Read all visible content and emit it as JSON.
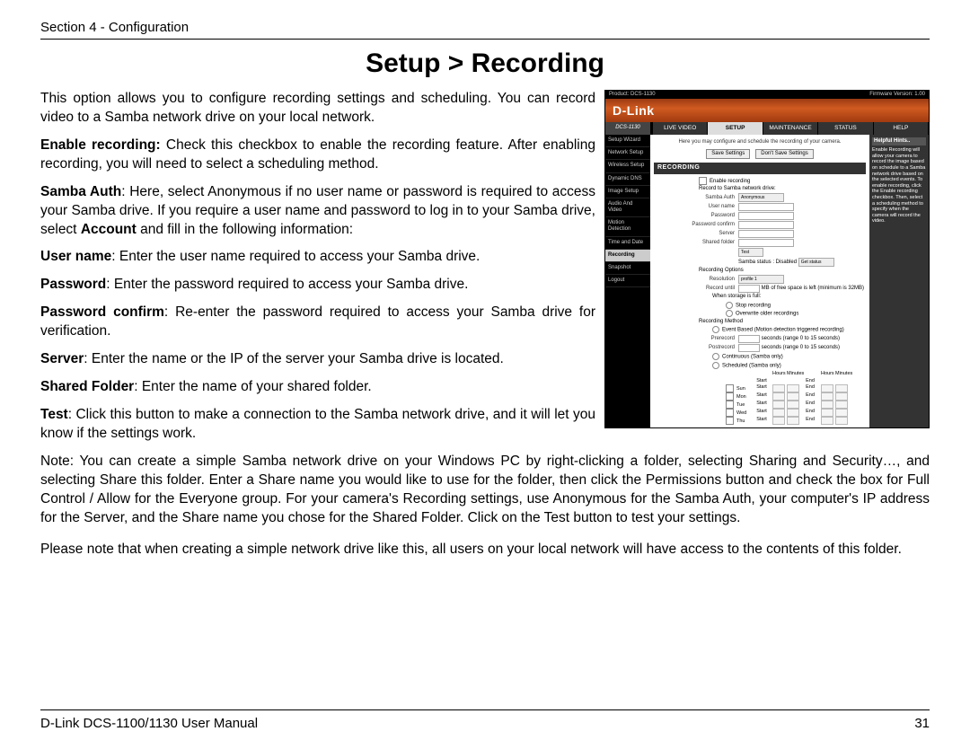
{
  "header": "Section 4 - Configuration",
  "title": "Setup > Recording",
  "intro": "This option allows you to configure recording settings and scheduling. You can record video to a Samba network drive on your local network.",
  "items": {
    "enable_b": "Enable recording:",
    "enable_t": " Check this checkbox to enable the recording feature. After enabling recording, you will need to select a scheduling method.",
    "samba_b": "Samba Auth",
    "samba_t1": ": Here, select Anonymous if no user name or password is required to access your Samba drive. If you require a user name and password to log in to your Samba drive, select ",
    "samba_b2": "Account",
    "samba_t2": " and fill in the following information:",
    "user_b": "User name",
    "user_t": ": Enter the user name required to access your Samba drive.",
    "pass_b": "Password",
    "pass_t": ": Enter the password required to access your Samba drive.",
    "passc_b": "Password confirm",
    "passc_t": ": Re-enter the password required to access your Samba drive for verification.",
    "server_b": "Server",
    "server_t": ": Enter the name or the IP of the server your Samba drive is located.",
    "shared_b": "Shared Folder",
    "shared_t": ": Enter the name of your shared folder.",
    "test_b": "Test",
    "test_t": ": Click this button to make a connection to the Samba network drive, and it will let you know if the settings work."
  },
  "note": {
    "b1": "Note",
    "t1": ": You can create a simple Samba network drive on your Windows PC by right-clicking a folder, selecting ",
    "b2": "Sharing and Security…",
    "t2": ", and selecting ",
    "b3": "Share this folder",
    "t3": ". Enter a ",
    "b4": "Share name",
    "t4": " you would like to use for the folder, then click the ",
    "b5": "Permissions",
    "t5": " button and check the box for ",
    "b6": "Full Control / Allow",
    "t6": " for the ",
    "b7": "Everyone",
    "t7": " group. For your camera's Recording settings, use Anonymous for the Samba Auth, your computer's IP address for the Server, and the Share name you chose for the Shared Folder. Click on the Test button to test your settings."
  },
  "closing": "Please note that when creating a simple network drive like this, all users on your local network will have access to the contents of this folder.",
  "footer_left": "D-Link DCS-1100/1130 User Manual",
  "footer_right": "31",
  "shot": {
    "product": "Product: DCS-1130",
    "fw": "Firmware Version: 1.00",
    "brand": "D-Link",
    "model": "DCS-1130",
    "tabs": [
      "LIVE VIDEO",
      "SETUP",
      "MAINTENANCE",
      "STATUS",
      "HELP"
    ],
    "side": [
      "Setup Wizard",
      "Network Setup",
      "Wireless Setup",
      "Dynamic DNS",
      "Image Setup",
      "Audio And Video",
      "Motion Detection",
      "Time and Date",
      "Recording",
      "Snapshot",
      "Logout"
    ],
    "desc": "Here you may configure and schedule the recording of your camera.",
    "btn_save": "Save Settings",
    "btn_dont": "Don't Save Settings",
    "sec_rec": "RECORDING",
    "f_enable": "Enable recording",
    "f_record_to": "Record to Samba network drive:",
    "f_samba_auth": "Samba Auth",
    "f_samba_val": "Anonymous",
    "f_user": "User name",
    "f_pass": "Password",
    "f_passc": "Password confirm",
    "f_server": "Server",
    "f_shared": "Shared folder",
    "f_test": "Test",
    "f_status": "Samba status : Disabled",
    "f_get": "Get status",
    "ro_h": "Recording Options",
    "ro_res": "Resolution",
    "ro_res_v": "profile 1",
    "ro_until": "Record until",
    "ro_until_t": "MB of free space is left (minimum is 32MB)",
    "ro_full": "When storage is full:",
    "ro_stop": "Stop recording",
    "ro_over": "Overwrite older recordings",
    "rm_h": "Recording Method",
    "rm_event": "Event Based (Motion detection triggered recording)",
    "rm_pre": "Prerecord",
    "rm_pre_t": "seconds (range 0 to 15 seconds)",
    "rm_post": "Postrecord",
    "rm_post_t": "seconds (range 0 to 15 seconds)",
    "rm_cont": "Continuous (Samba only)",
    "rm_sched": "Scheduled (Samba only)",
    "sched_h": [
      "",
      "Start",
      "End"
    ],
    "sched_sub": [
      "Hours",
      "Minutes",
      "Hours",
      "Minutes"
    ],
    "days": [
      "Sun",
      "Mon",
      "Tue",
      "Wed",
      "Thu"
    ],
    "hints_h": "Helpful Hints..",
    "hints_t": "Enable Recording will allow your camera to record the image based on schedule to a Samba network drive based on the selected events. To enable recording, click the Enable recording checkbox. Then, select a scheduling method to specify when the camera will record the video."
  }
}
